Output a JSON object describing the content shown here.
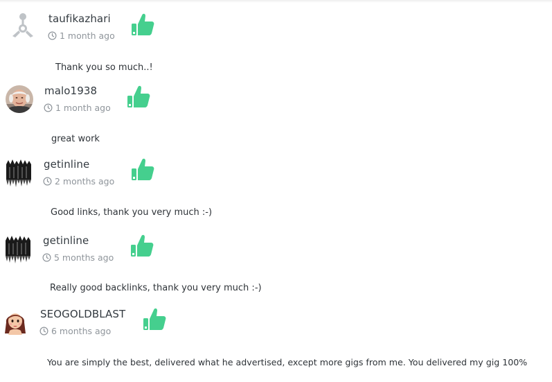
{
  "reviews": [
    {
      "username": "taufikazhari",
      "time": "1 month ago",
      "comment": "Thank you so much..!",
      "avatar": "default-avatar-icon"
    },
    {
      "username": "malo1938",
      "time": "1 month ago",
      "comment": "great work",
      "avatar": "photo-avatar"
    },
    {
      "username": "getinline",
      "time": "2 months ago",
      "comment": "Good links, thank you very much :-)",
      "avatar": "dark-graphic-avatar"
    },
    {
      "username": "getinline",
      "time": "5 months ago",
      "comment": "Really good backlinks, thank you very much :-)",
      "avatar": "dark-graphic-avatar"
    },
    {
      "username": "SEOGOLDBLAST",
      "time": "6 months ago",
      "comment": "You are simply the best, delivered what he advertised, except more gigs from me. You delivered my gig 100%",
      "avatar": "cartoon-woman-avatar"
    }
  ],
  "colors": {
    "thumb": "#45cf8e",
    "muted": "#8f959b",
    "text": "#2e3338"
  },
  "icons": {
    "clock": "clock-icon",
    "like": "thumbs-up-icon"
  }
}
